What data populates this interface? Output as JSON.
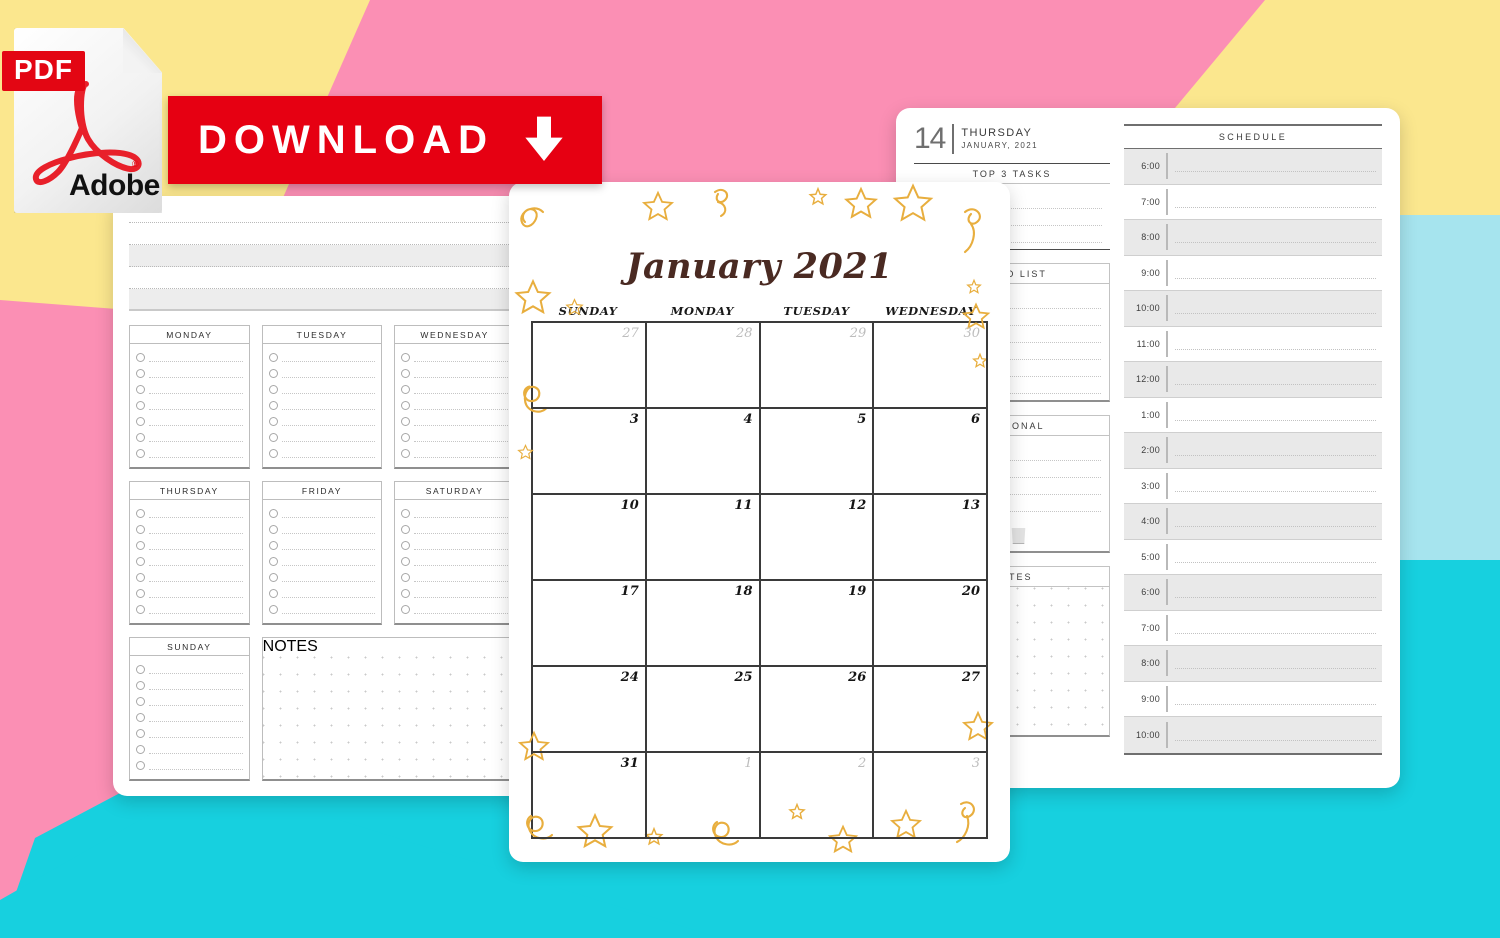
{
  "background": {
    "yellow": "#FBE78E",
    "pink": "#FB8FB4",
    "light_blue": "#A6E4EE",
    "cyan": "#17D0DF"
  },
  "pdf_badge": {
    "label": "PDF",
    "brand": "Adobe",
    "registered_mark": "®",
    "color": "#E30613"
  },
  "download_button": {
    "label": "DOWNLOAD",
    "icon": "download-arrow-icon",
    "color": "#E60012"
  },
  "weekly_page": {
    "header_rows": [
      "",
      "",
      ""
    ],
    "days": [
      {
        "title": "MONDAY",
        "rows": 7
      },
      {
        "title": "TUESDAY",
        "rows": 7
      },
      {
        "title": "WEDNESDAY",
        "rows": 7
      },
      {
        "title": "THURSDAY",
        "rows": 7
      },
      {
        "title": "FRIDAY",
        "rows": 7
      },
      {
        "title": "SATURDAY",
        "rows": 7
      },
      {
        "title": "SUNDAY",
        "rows": 7
      }
    ],
    "notes_title": "NOTES"
  },
  "calendar_page": {
    "title": "January 2021",
    "weekdays": [
      "SUNDAY",
      "MONDAY",
      "TUESDAY",
      "WEDNESDAY"
    ],
    "weeks": [
      [
        {
          "d": "27",
          "muted": true
        },
        {
          "d": "28",
          "muted": true
        },
        {
          "d": "29",
          "muted": true
        },
        {
          "d": "30",
          "muted": true
        }
      ],
      [
        {
          "d": "3",
          "muted": false
        },
        {
          "d": "4",
          "muted": false
        },
        {
          "d": "5",
          "muted": false
        },
        {
          "d": "6",
          "muted": false
        }
      ],
      [
        {
          "d": "10",
          "muted": false
        },
        {
          "d": "11",
          "muted": false
        },
        {
          "d": "12",
          "muted": false
        },
        {
          "d": "13",
          "muted": false
        }
      ],
      [
        {
          "d": "17",
          "muted": false
        },
        {
          "d": "18",
          "muted": false
        },
        {
          "d": "19",
          "muted": false
        },
        {
          "d": "20",
          "muted": false
        }
      ],
      [
        {
          "d": "24",
          "muted": false
        },
        {
          "d": "25",
          "muted": false
        },
        {
          "d": "26",
          "muted": false
        },
        {
          "d": "27",
          "muted": false
        }
      ],
      [
        {
          "d": "31",
          "muted": false
        },
        {
          "d": "1",
          "muted": true
        },
        {
          "d": "2",
          "muted": true
        },
        {
          "d": "3",
          "muted": true
        }
      ]
    ],
    "decoration_color": "#E8AE3E"
  },
  "daily_page": {
    "date_number": "14",
    "weekday": "THURSDAY",
    "month_year": "JANUARY, 2021",
    "panels": [
      {
        "title": "TOP 3 TASKS",
        "lines": 3
      },
      {
        "title": "TO DO LIST",
        "lines": 6
      },
      {
        "title": "PERSONAL",
        "lines": 4,
        "water_glasses": 5
      },
      {
        "title": "NOTES",
        "lines": 0,
        "dotgrid": true
      }
    ],
    "schedule": {
      "title": "SCHEDULE",
      "times": [
        "6:00",
        "7:00",
        "8:00",
        "9:00",
        "10:00",
        "11:00",
        "12:00",
        "1:00",
        "2:00",
        "3:00",
        "4:00",
        "5:00",
        "6:00",
        "7:00",
        "8:00",
        "9:00",
        "10:00"
      ]
    }
  }
}
